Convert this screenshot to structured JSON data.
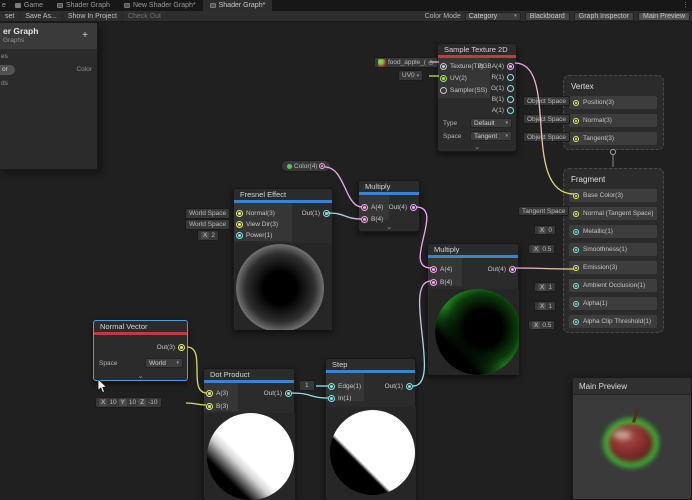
{
  "tab_bar": {
    "overflow_icon": "⋮",
    "tabs": [
      {
        "label": "e"
      },
      {
        "label": "Game"
      },
      {
        "label": "Shader Graph"
      },
      {
        "label": "New Shader Graph*"
      },
      {
        "label": "Shader Graph*"
      }
    ]
  },
  "toolbar": {
    "save_asset": "set",
    "save_as": "Save As...",
    "show_in_project": "Show In Project",
    "check_out": "Check Out",
    "color_mode_label": "Color Mode",
    "color_mode_value": "Category",
    "blackboard": "Blackboard",
    "graph_inspector": "Graph Inspector",
    "main_preview": "Main Preview"
  },
  "blackboard": {
    "title": "er Graph",
    "subtitle": "Graphs",
    "add_button": "+",
    "row_properties": "es",
    "property_pill": "or",
    "property_type": "Color",
    "row_keywords": "ds"
  },
  "nodes": {
    "sample_texture": {
      "title": "Sample Texture 2D",
      "texture_value": "food_apple_(",
      "uv_channel": "UV0",
      "inputs": [
        "Texture(T2)",
        "UV(2)",
        "Sampler(SS)"
      ],
      "outputs": [
        "RGBA(4)",
        "R(1)",
        "G(1)",
        "B(1)",
        "A(1)"
      ],
      "type_label": "Type",
      "type_value": "Default",
      "space_label": "Space",
      "space_value": "Tangent"
    },
    "color_property": {
      "label": "Color(4)"
    },
    "fresnel": {
      "title": "Fresnel Effect",
      "out": "Out(1)",
      "inputs": [
        {
          "pill": "World Space",
          "label": "Normal(3)"
        },
        {
          "pill": "World Space",
          "label": "View Dir(3)"
        },
        {
          "pill_axis": "X",
          "pill_value": "2",
          "label": "Power(1)"
        }
      ]
    },
    "multiply1": {
      "title": "Multiply",
      "a": "A(4)",
      "b": "B(4)",
      "out": "Out(4)"
    },
    "multiply2": {
      "title": "Multiply",
      "a": "A(4)",
      "b": "B(4)",
      "out": "Out(4)"
    },
    "normal_vector": {
      "title": "Normal Vector",
      "out": "Out(3)",
      "space_label": "Space",
      "space_value": "World"
    },
    "dot_product": {
      "title": "Dot Product",
      "a": "A(3)",
      "b": "B(3)",
      "out": "Out(1)",
      "b_vector": [
        {
          "axis": "X",
          "value": "10"
        },
        {
          "axis": "Y",
          "value": "10"
        },
        {
          "axis": "Z",
          "value": "-10"
        }
      ]
    },
    "step": {
      "title": "Step",
      "edge": "Edge(1)",
      "input": "In(1)",
      "out": "Out(1)",
      "edge_value": "1"
    },
    "vertex": {
      "title": "Vertex",
      "rows": [
        {
          "pill": "Object Space",
          "label": "Position(3)"
        },
        {
          "pill": "Object Space",
          "label": "Normal(3)"
        },
        {
          "pill": "Object Space",
          "label": "Tangent(3)"
        }
      ]
    },
    "fragment": {
      "title": "Fragment",
      "rows": [
        {
          "label": "Base Color(3)"
        },
        {
          "pill": "Tangent Space",
          "label": "Normal (Tangent Space)(3)"
        },
        {
          "pill_axis": "X",
          "pill_value": "0",
          "label": "Metallic(1)"
        },
        {
          "pill_axis": "X",
          "pill_value": "0.5",
          "label": "Smoothness(1)"
        },
        {
          "label": "Emission(3)"
        },
        {
          "pill_axis": "X",
          "pill_value": "1",
          "label": "Ambient Occlusion(1)"
        },
        {
          "pill_axis": "X",
          "pill_value": "1",
          "label": "Alpha(1)"
        },
        {
          "pill_axis": "X",
          "pill_value": "0.5",
          "label": "Alpha Clip Threshold(1)"
        }
      ]
    }
  },
  "main_preview_panel": {
    "title": "Main Preview"
  },
  "glyphs": {
    "dropdown_arrow": "▾",
    "collapse_chevron": "⌄",
    "object_picker": "⊙"
  },
  "colors": {
    "category_math_blue": "#3b82d0",
    "category_input_red": "#c03c3c",
    "port_vector1": "#84e4e7",
    "port_vector2": "#a9e65a",
    "port_vector3": "#eaea70",
    "port_vector4": "#f5a6ef",
    "selection_blue": "#4f9fe0"
  }
}
